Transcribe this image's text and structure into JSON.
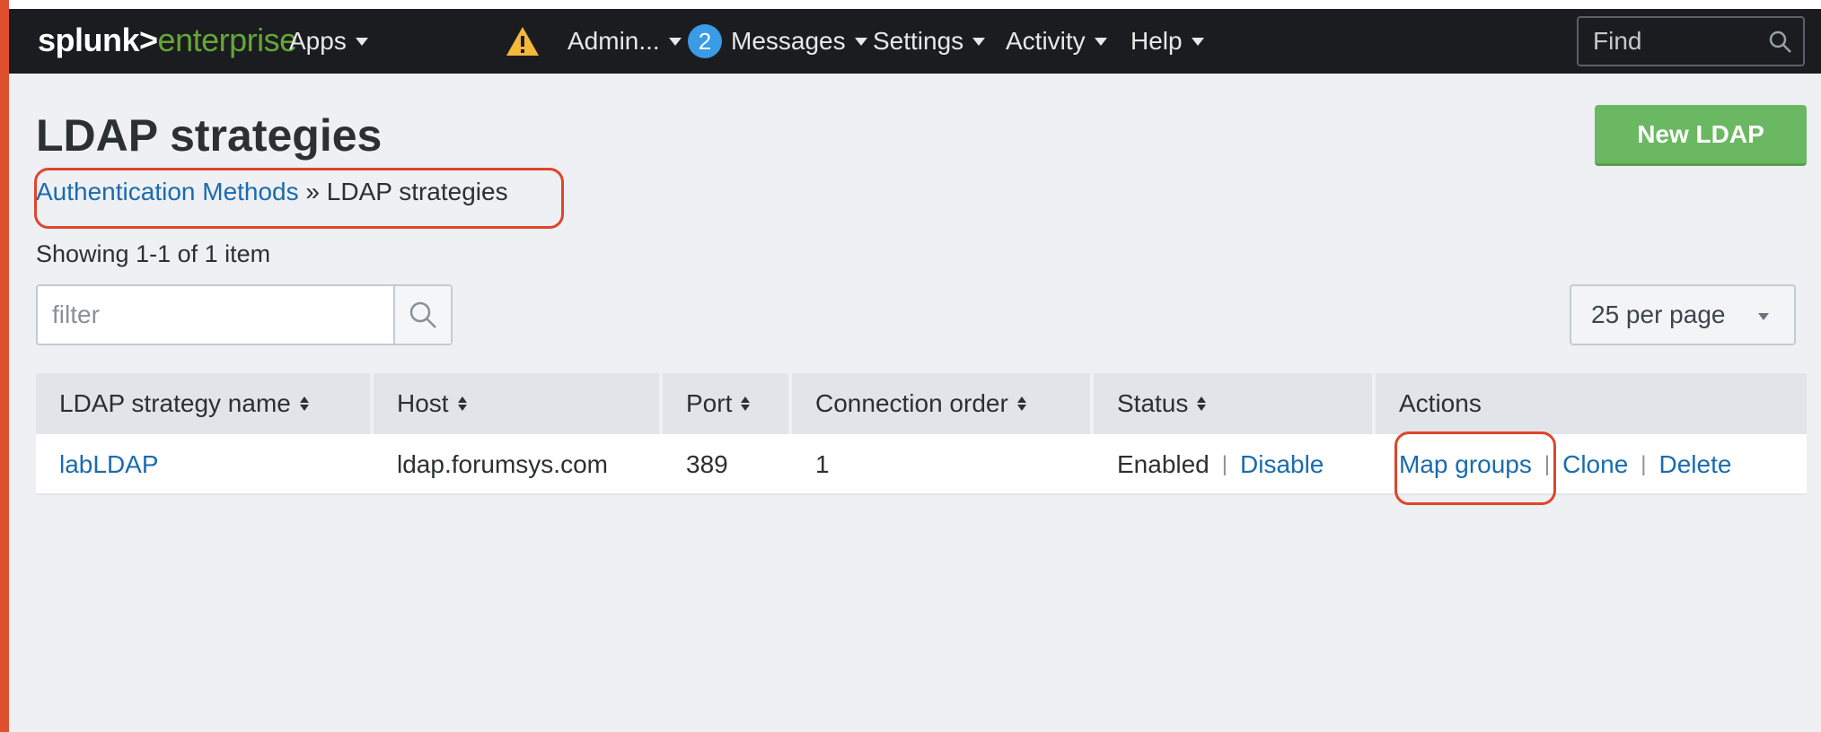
{
  "topbar": {
    "logo_splunk": "splunk>",
    "logo_enterprise": "enterprise",
    "apps_label": "Apps",
    "admin_label": "Admin...",
    "messages_count": "2",
    "messages_label": "Messages",
    "settings_label": "Settings",
    "activity_label": "Activity",
    "help_label": "Help",
    "find_label": "Find"
  },
  "page": {
    "title": "LDAP strategies",
    "new_button": "New LDAP",
    "breadcrumb_link": "Authentication Methods",
    "breadcrumb_sep": "»",
    "breadcrumb_current": "LDAP strategies",
    "count_text": "Showing 1-1 of 1 item",
    "filter_placeholder": "filter",
    "per_page": "25 per page"
  },
  "table": {
    "headers": [
      "LDAP strategy name",
      "Host",
      "Port",
      "Connection order",
      "Status",
      "Actions"
    ],
    "rows": [
      {
        "name": "labLDAP",
        "host": "ldap.forumsys.com",
        "port": "389",
        "order": "1",
        "status": "Enabled",
        "status_action": "Disable",
        "actions": [
          "Map groups",
          "Clone",
          "Delete"
        ]
      }
    ]
  },
  "colors": {
    "accent_link": "#1a6bb0",
    "brand_green": "#65a637",
    "button_green": "#6bb862",
    "highlight_red": "#e0452a",
    "topbar_bg": "#1a1c20"
  }
}
